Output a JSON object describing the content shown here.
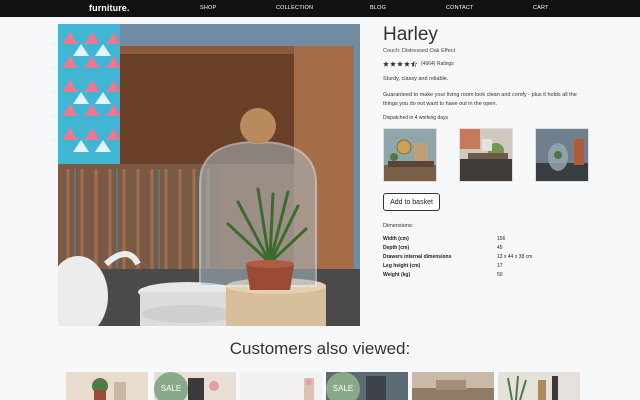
{
  "nav": {
    "brand": "furniture",
    "brand_dot": ".",
    "links": [
      "SHOP",
      "COLLECTION",
      "BLOG",
      "CONTACT",
      "CART"
    ]
  },
  "product": {
    "title": "Harley",
    "subtitle": "Couch: Distressed Oak Effect",
    "rating_stars": 4.5,
    "rating_text": "(4664) Ratings",
    "tagline": "Sturdy, classy and reliable.",
    "description": "Guaranteed to make your living room look clean and comfy - plus it holds all the things you do not want to have out in the open.",
    "dispatch": "Dispatched in 4 working days",
    "add_to_basket": "Add to basket",
    "dimensions_label": "Dimensions:",
    "dimensions": [
      {
        "label": "Width (cm)",
        "value": "156"
      },
      {
        "label": "Depth (cm)",
        "value": "45"
      },
      {
        "label": "Drawers internal dimensions",
        "value": "13 x 44 x 38 cm"
      },
      {
        "label": "Leg height (cm)",
        "value": "17"
      },
      {
        "label": "Weight (kg)",
        "value": "50"
      }
    ]
  },
  "also_viewed": {
    "heading": "Customers also viewed:",
    "sale_label": "SALE"
  },
  "colors": {
    "nav_bg": "#111111",
    "page_bg": "#f7f8fa",
    "sale_badge": "#8aa98a",
    "star": "#333333"
  }
}
